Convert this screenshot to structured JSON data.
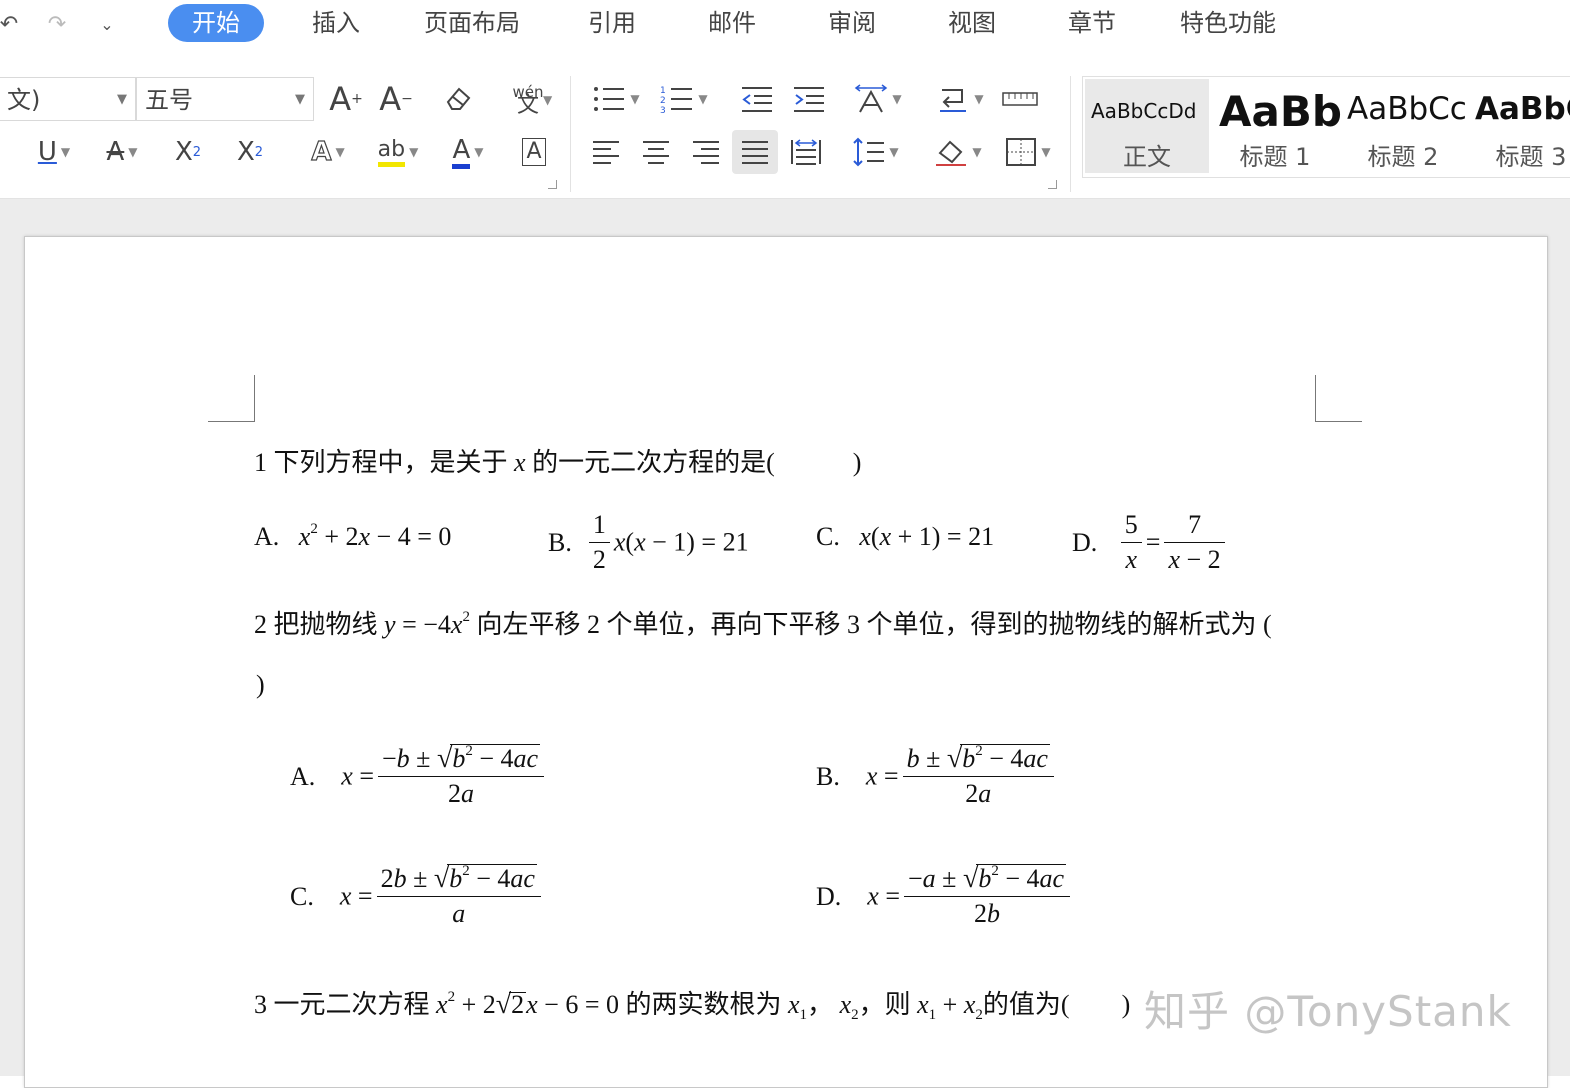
{
  "menu": {
    "tabs": [
      "开始",
      "插入",
      "页面布局",
      "引用",
      "邮件",
      "审阅",
      "视图",
      "章节",
      "特色功能"
    ],
    "active_tab": "开始"
  },
  "ribbon": {
    "font_name": "文)",
    "font_size": "五号",
    "icons": {
      "grow_font": "A⁺",
      "shrink_font": "A⁻",
      "pinyin": "wén"
    }
  },
  "styles": [
    {
      "sample": "AaBbCcDd",
      "name": "正文"
    },
    {
      "sample": "AaBb",
      "name": "标题 1"
    },
    {
      "sample": "AaBbCc",
      "name": "标题 2"
    },
    {
      "sample": "AaBbC",
      "name": "标题 3"
    }
  ],
  "document": {
    "q1": {
      "number": "1",
      "text_a": "下列方程中，是关于",
      "var": "x",
      "text_b": "的一元二次方程的是",
      "blank": "(　　　)",
      "options": {
        "A": {
          "label": "A.",
          "expr": "x² + 2x − 4 = 0"
        },
        "B": {
          "label": "B.",
          "expr": "½x(x − 1) = 21"
        },
        "C": {
          "label": "C.",
          "expr": "x(x + 1) = 21"
        },
        "D": {
          "label": "D.",
          "expr": "5/x = 7/(x − 2)"
        }
      }
    },
    "q2": {
      "number": "2",
      "text_a": "把抛物线",
      "text_b": "向左平移 2 个单位，再向下平移 3 个单位，得到的抛物线的解析式为",
      "open_paren": "(",
      "close_paren": ")",
      "options": {
        "A": {
          "label": "A."
        },
        "B": {
          "label": "B."
        },
        "C": {
          "label": "C."
        },
        "D": {
          "label": "D."
        }
      }
    },
    "q3": {
      "number": "3",
      "text_a": "一元二次方程",
      "text_b": "的两实数根为",
      "text_c": "，则",
      "text_d": "的值为",
      "blank": "(　　)"
    }
  },
  "watermark": "知乎 @TonyStank",
  "colors": {
    "accent": "#4a8ef0",
    "highlight": "#f2e600",
    "font_color": "#1a3fd0"
  }
}
